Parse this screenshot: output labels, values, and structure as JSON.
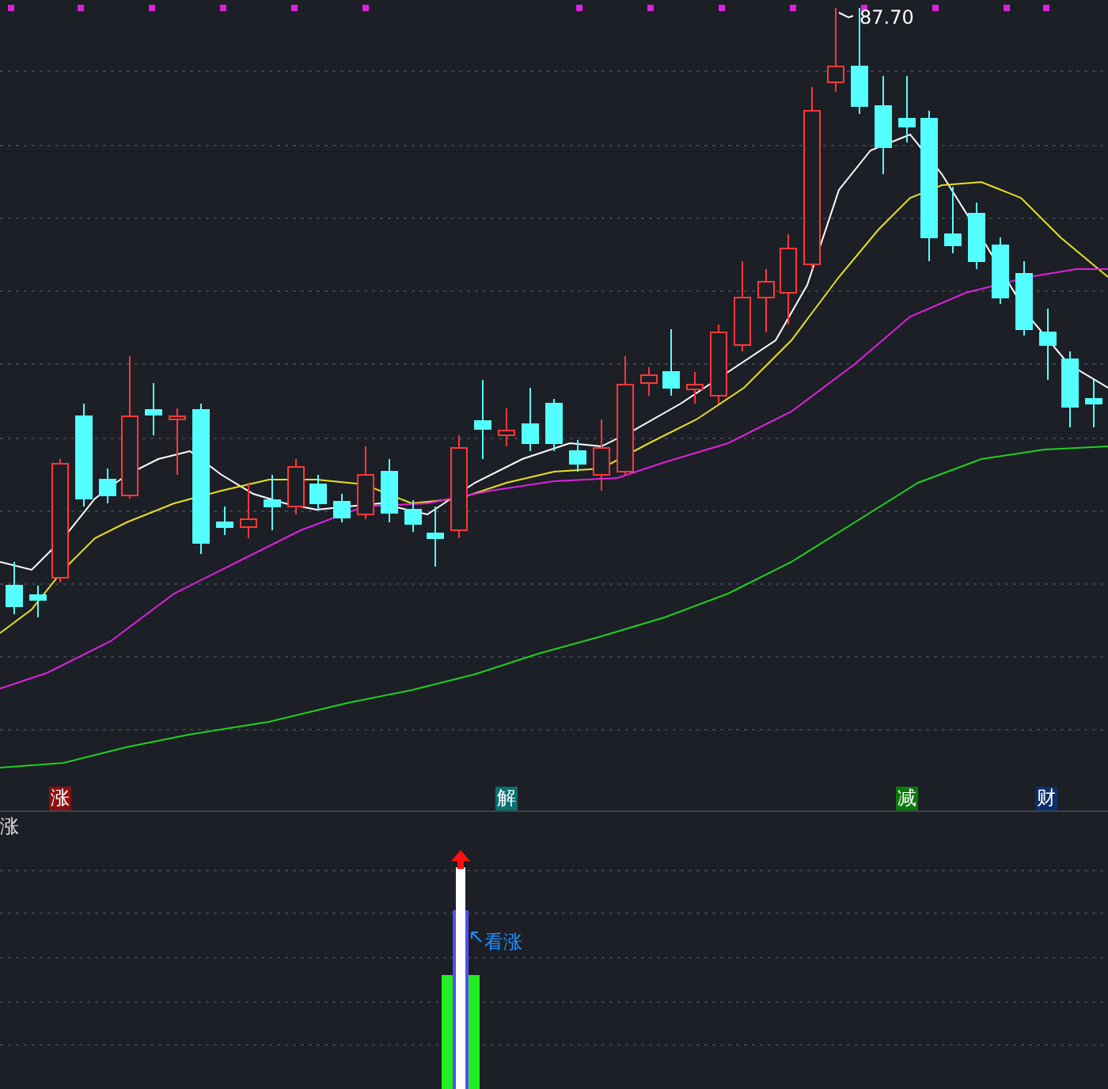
{
  "main_chart": {
    "high_label": "87.70",
    "events": [
      {
        "label": "涨",
        "color": "#8a1010"
      },
      {
        "label": "解",
        "color": "#0a7070"
      },
      {
        "label": "减",
        "color": "#0a7a0a"
      },
      {
        "label": "财",
        "color": "#0c2f6a"
      }
    ]
  },
  "indicator": {
    "title": "涨",
    "signal_label": "看涨"
  }
}
